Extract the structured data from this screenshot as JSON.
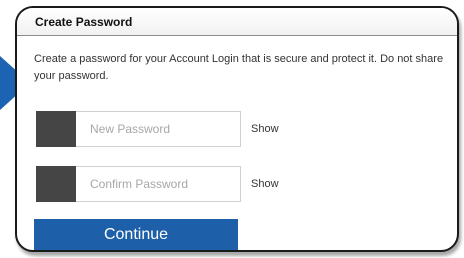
{
  "dialog": {
    "title": "Create Password",
    "description": "Create a password for your Account Login that is secure and protect it. Do not share your password."
  },
  "fields": {
    "new_password": {
      "placeholder": "New Password",
      "show_label": "Show"
    },
    "confirm_password": {
      "placeholder": "Confirm Password",
      "show_label": "Show"
    }
  },
  "actions": {
    "continue_label": "Continue"
  },
  "colors": {
    "accent": "#1d5fa8",
    "pointer": "#1d63b4",
    "field_swatch": "#454545"
  }
}
